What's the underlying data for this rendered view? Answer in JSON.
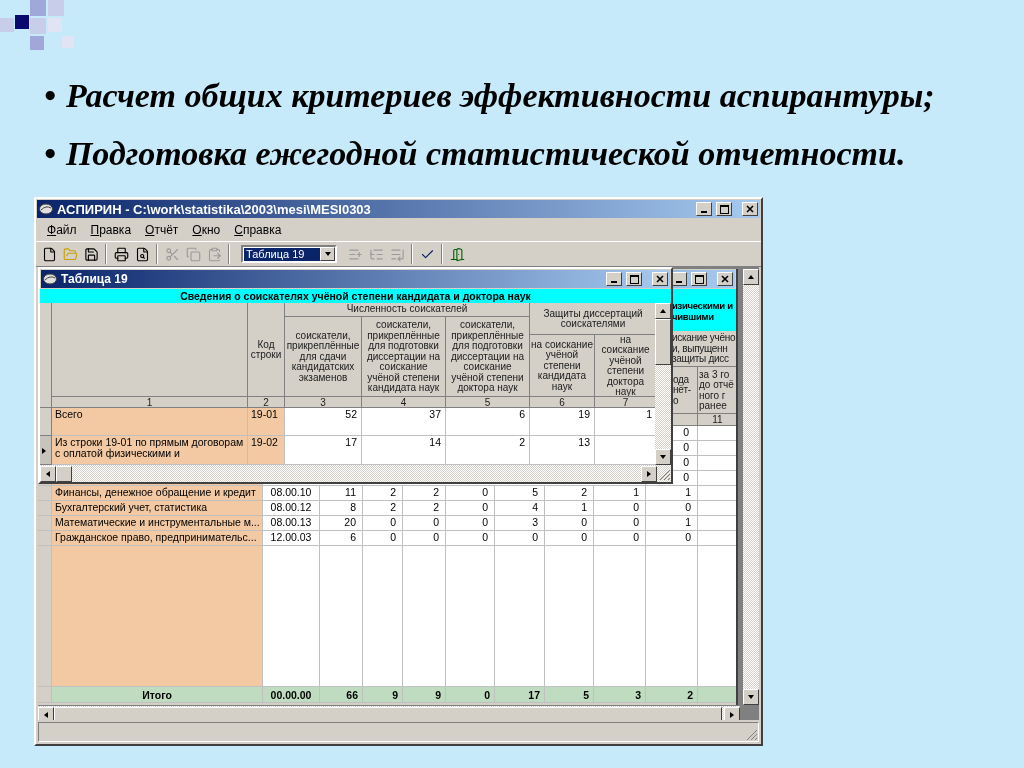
{
  "slide": {
    "bullets": [
      {
        "mark": "•",
        "text": "Расчет общих критериев эффективности аспирантуры;"
      },
      {
        "mark": "•",
        "text": "Подготовка ежегодной статистической отчетности."
      }
    ]
  },
  "app": {
    "title": "АСПИРИН - C:\\work\\statistika\\2003\\mesi\\MESI0303",
    "menu": [
      "Файл",
      "Правка",
      "Отчёт",
      "Окно",
      "Справка"
    ],
    "toolbar": [
      {
        "kind": "new",
        "disabled": false
      },
      {
        "kind": "open",
        "disabled": false
      },
      {
        "kind": "save",
        "disabled": false
      },
      {
        "kind": "separator"
      },
      {
        "kind": "print",
        "disabled": false
      },
      {
        "kind": "preview",
        "disabled": false
      },
      {
        "kind": "separator"
      },
      {
        "kind": "cut",
        "disabled": true
      },
      {
        "kind": "copy",
        "disabled": true
      },
      {
        "kind": "paste",
        "disabled": true
      },
      {
        "kind": "separator"
      },
      {
        "kind": "combo",
        "value": "Таблица 19"
      },
      {
        "kind": "insert_row",
        "disabled": true
      },
      {
        "kind": "split_row",
        "disabled": true
      },
      {
        "kind": "move_row",
        "disabled": true
      },
      {
        "kind": "separator"
      },
      {
        "kind": "check",
        "disabled": false
      },
      {
        "kind": "separator"
      },
      {
        "kind": "exit",
        "disabled": false
      }
    ]
  },
  "back_table": {
    "caption": "изическими и\nчившими",
    "group_header": "искание учёно\nи, выпущенн\nзащиты дисс",
    "column_10_header": "ода\nнёт-\nо",
    "column_11_header": "за 3 го\nдо отчё\nного г\nранее",
    "column_11_number": "11",
    "hidden_rows": [
      {
        "column_10": "0"
      },
      {
        "column_10": "0"
      },
      {
        "column_10": "0"
      },
      {
        "column_10": "0"
      }
    ],
    "rows": [
      {
        "name": "Финансы, денежное обращение и кредит",
        "code": "08.00.10",
        "values": [
          "11",
          "2",
          "2",
          "0",
          "5",
          "2",
          "1",
          "1"
        ]
      },
      {
        "name": "Бухгалтерский учет, статистика",
        "code": "08.00.12",
        "values": [
          "8",
          "2",
          "2",
          "0",
          "4",
          "1",
          "0",
          "0"
        ]
      },
      {
        "name": "Математические и инструментальные м...",
        "code": "08.00.13",
        "values": [
          "20",
          "0",
          "0",
          "0",
          "3",
          "0",
          "0",
          "1"
        ]
      },
      {
        "name": "Гражданское право, предпринимательс...",
        "code": "12.00.03",
        "values": [
          "6",
          "0",
          "0",
          "0",
          "0",
          "0",
          "0",
          "0"
        ]
      }
    ],
    "total": {
      "name": "Итого",
      "code": "00.00.00",
      "values": [
        "66",
        "9",
        "9",
        "0",
        "17",
        "5",
        "3",
        "2"
      ]
    }
  },
  "table_window": {
    "title": "Таблица 19",
    "caption": "Сведения о соискателях учёной степени кандидата и доктора наук",
    "code_header": "Код строки",
    "count_group": "Численность соискателей",
    "count_columns": [
      "соискатели, прикреплённые для сдачи кандидатских экзаменов",
      "соискатели, прикреплённые для подготовки диссертации на соискание учёной степени кандидата наук",
      "соискатели, прикреплённые для подготовки диссертации на соискание учёной степени доктора наук"
    ],
    "defense_group": "Защиты диссертаций соискателями",
    "defense_columns": [
      "на соискание учёной степени кандидата наук",
      "на соискание учёной степени доктора наук"
    ],
    "column_numbers": [
      "1",
      "2",
      "3",
      "4",
      "5",
      "6",
      "7"
    ],
    "rows": [
      {
        "name": "Всего",
        "code": "19-01",
        "values": [
          "52",
          "37",
          "6",
          "19",
          "1"
        ],
        "selected": false
      },
      {
        "name": "Из строки 19-01 по прямым договорам\nс оплатой физическими и",
        "code": "19-02",
        "values": [
          "17",
          "14",
          "2",
          "13"
        ],
        "selected": true
      }
    ]
  }
}
